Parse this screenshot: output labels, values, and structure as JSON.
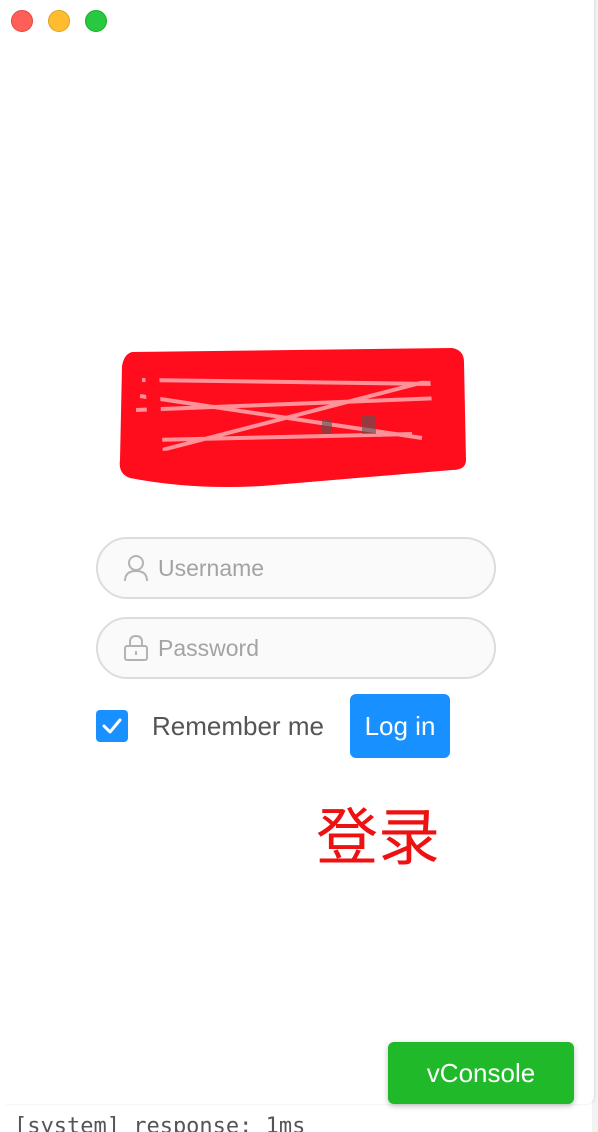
{
  "backdrop": {
    "text": "[system] response: 1ms"
  },
  "window": {
    "controls": {
      "close": "close-button",
      "minimize": "minimize-button",
      "maximize": "zoom-button"
    }
  },
  "logo": {
    "state": "redacted",
    "redaction_color": "#ff0d1d"
  },
  "form": {
    "username": {
      "placeholder": "Username",
      "value": "",
      "icon": "user-icon"
    },
    "password": {
      "placeholder": "Password",
      "value": "",
      "icon": "lock-icon"
    },
    "remember": {
      "label": "Remember me",
      "checked": true
    },
    "login_label": "Log in"
  },
  "annotation": {
    "text": "登录",
    "color": "#ee1111"
  },
  "vconsole": {
    "label": "vConsole"
  },
  "colors": {
    "primary": "#1890ff",
    "vconsole": "#1fb92a"
  }
}
